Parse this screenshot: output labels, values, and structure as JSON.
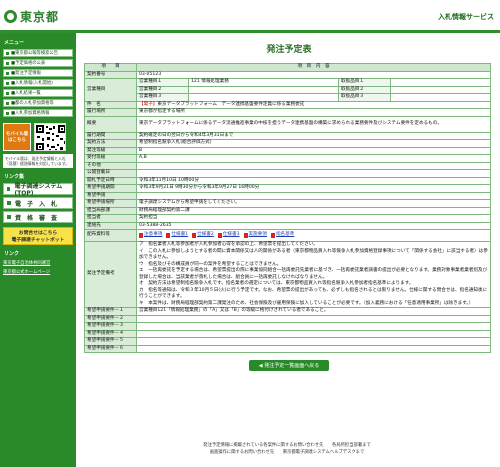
{
  "header": {
    "logo_text": "東京都",
    "service_title": "入札情報サービス"
  },
  "sidebar": {
    "menu_heading": "メニュー",
    "menu_items": [
      "■東京都公報等検索公告",
      "■予定価格の公表",
      "■発注予定情報",
      "■入札情報(入札開始)",
      "■入札結果一覧",
      "■都の入札参加資格等",
      "■入札参加資格情報"
    ],
    "mobile_label_1": "モバイル版",
    "mobile_label_2": "はこちら",
    "mobile_note": "モバイル版は、発注予定情報と入札（見積）経過情報を対応しています。",
    "links_heading": "リンク集",
    "big_buttons": [
      "電子調達システム(TOP)",
      "電　子　入　札",
      "資　格　審　査"
    ],
    "banner_line1": "お問合せはこちら",
    "banner_line2": "電子調達チャットボット",
    "footer_heading": "リンク",
    "footer_links": [
      "東京電子自治体共同運営",
      "東京都公式ホームページ"
    ]
  },
  "main": {
    "title": "発注予定表",
    "header_col1": "項　　目",
    "header_col2": "項　目　内　容",
    "rows": {
      "contract_no_label": "契約番号",
      "contract_no": "03-05123",
      "category_label": "営業種目",
      "category1_label": "営業種目１",
      "category1_value": "121 情報処理業務",
      "subcategory1_label": "取扱品目１",
      "category2_label": "営業種目２",
      "subcategory2_label": "取扱品目２",
      "category3_label": "営業種目３",
      "subcategory3_label": "取扱品目３",
      "subject_label": "件　名",
      "subject_tag": "【電子】",
      "subject_value": "東京データプラットフォーム　データ連携基盤要件定義に係る業務委託",
      "place_label": "履行場所",
      "place_value": "東京都が指定する場所",
      "summary_label": "概要",
      "summary_value": "東京データプラットフォームに係るデータ流通推進事業の中核を担うデータ連携基盤の構築に求められる業務要件及びシステム要件を定めるもの。",
      "period_label": "履行期間",
      "period_value": "契約確定の日の翌日から令和4年3月31日まで",
      "method_label": "契約方法",
      "method_value": "希望制指名競争入札(総合評価方式)",
      "rank_label": "発注等級",
      "rank_value": "B",
      "accept_rank_label": "受付等級",
      "accept_rank_value": "A,B",
      "other_label": "その他",
      "publish_label": "公開登載日",
      "open_label": "開札予定日時",
      "open_value": "令和3年11月10日 10時00分",
      "apply_period_label": "希望申請期間",
      "apply_period_value": "令和3年9月21日 9時30分から令和3年9月27日 16時00分",
      "apply_method_label": "希望申請",
      "apply_system_label": "希望申請場所",
      "apply_system_value": "電子調達システムから希望申請をしてください。",
      "dept_label": "担当局部課",
      "dept_value": "財務局経理部契約第二課",
      "person_label": "担当者",
      "person_value": "契約担当",
      "tel_label": "連絡先",
      "tel_value": "03-5388-2635",
      "docs_label": "配布資料等",
      "docs": [
        "注意事項",
        "仕様書1",
        "仕様書2",
        "仕様書3",
        "実施要領",
        "指名基準"
      ],
      "notes_label": "発注予定備考",
      "notes_lines": [
        "ア　指名業者入札等参加者が入札参加者心得を承認の上、希望票を提出してください。",
        "イ　この入札に参加しようとする者の間に資本関係又は人的関係がある者（東京都物品買入れ等競争入札参加資格登録事項について「関係する会社」に該当する者）は参加できません。",
        "ウ　指名及びその構成員が同一の案件を希望することはできません。",
        "エ　一括再委託を予定する場合は、希望票提出の際に事業協同組合一括再委託先業者に基づき、一括再委託業者調書の提出が必要となります。業務対象事業者業者別及び登録した場合は、当該業者が落札した場合は、組合員に一括再委託しなければなりません。",
        "オ　契約方法は希望制指名競争入札です。指名業者の選定については、東京都物品買入れ等指名競争入札参加者指名基準によります。",
        "カ　指名等通知は、令和３年10月５日(火)に行う予定です。なお、希望票の提出があっても、必ずしも指名されるとは限りません。仕様に関する問合せは、指名通知後に行うことができます。",
        "キ　本案件は、財務局経理部契約第二課発注のため、社会保険及び雇用保険に加入していることが必要です。（加入義務における「任意適用事業所」は除きます。）"
      ],
      "cond1_label": "希望申請要件－１",
      "cond1_value": "営業種目121「情報処理業務」の「A」又は「B」の等級に格付けされている者であること。",
      "cond2_label": "希望申請要件－２",
      "cond3_label": "希望申請要件－３",
      "cond4_label": "希望申請要件－４",
      "cond5_label": "希望申請要件－５",
      "cond6_label": "希望申請要件－６"
    },
    "back_button": "発注予定一覧画面へ戻る"
  },
  "footer": {
    "line1": "発注予定情報に掲載されている各案件に関するお問い合わせ先　　各局所担当部署まで",
    "line2": "画面操作に関するお問い合わせ先　　東京都電子調達システムヘルプデスクまで"
  },
  "colors": {
    "sidebar_green": "#2a8a2a",
    "label_green": "#d8ecd8",
    "accent_red": "#cc0000",
    "banner_yellow": "#f7e24a"
  }
}
